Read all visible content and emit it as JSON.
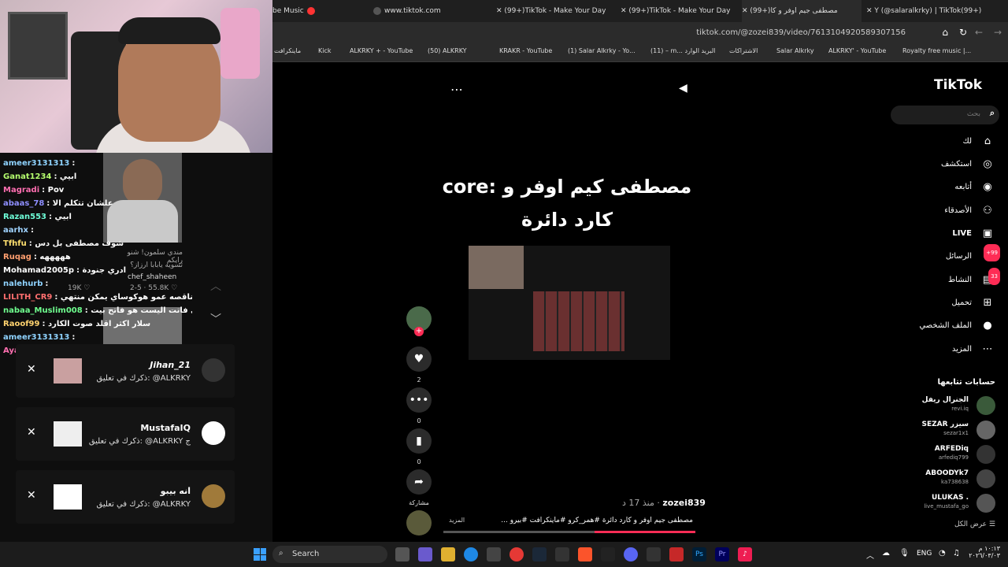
{
  "browser": {
    "tabs": [
      {
        "label": "be Music"
      },
      {
        "label": "www.tiktok.com"
      },
      {
        "label": "(99+)TikTok - Make Your Day"
      },
      {
        "label": "(99+)TikTok - Make Your Day"
      },
      {
        "label": "(99+)مصطفى جيم اوفر و كا"
      },
      {
        "label": "Y (@salaralkrky) | TikTok(99+)"
      }
    ],
    "url": "tiktok.com/@zozei839/video/7613104920589307156",
    "bookmarks": [
      "ماينكرافت",
      "Kick",
      "ALKRKY + - YouTube",
      "(50) ALKRKY",
      "KRAKR - YouTube",
      "(1) Salar Alkrky - Yo...",
      "(11) – m... البريد الوارد",
      "الاشتراكات",
      "Salar Alkrky",
      "ALKRKY' - YouTube",
      "Royalty free music |..."
    ]
  },
  "tiktok": {
    "logo": "TikTok",
    "search_placeholder": "بحث",
    "nav": [
      {
        "label": "لك",
        "icon": "home-icon"
      },
      {
        "label": "استكشف",
        "icon": "compass-icon"
      },
      {
        "label": "أتابعه",
        "icon": "following-icon"
      },
      {
        "label": "الأصدقاء",
        "icon": "friends-icon"
      },
      {
        "label": "LIVE",
        "icon": "live-icon"
      },
      {
        "label": "الرسائل",
        "icon": "messages-icon",
        "badge": "+99"
      },
      {
        "label": "النشاط",
        "icon": "activity-icon",
        "badge": "33"
      },
      {
        "label": "تحميل",
        "icon": "upload-icon"
      },
      {
        "label": "الملف الشخصي",
        "icon": "profile-icon"
      },
      {
        "label": "المزيد",
        "icon": "more-icon"
      }
    ],
    "following_title": "حسابات تتابعها",
    "following": [
      {
        "name": "الجنرال ريفل",
        "handle": "revi.iq"
      },
      {
        "name": "SEZAR سيزر",
        "handle": "sezar1x1"
      },
      {
        "name": "ARFEDiq",
        "handle": "arfediq799"
      },
      {
        "name": "ABOODYk7",
        "handle": "ka738638"
      },
      {
        "name": "ULUKAS .",
        "handle": "live_mustafa_go"
      }
    ],
    "see_all": "عرض الكل",
    "video": {
      "title": "مصطفى كيم اوفر و :core كارد دائرة",
      "author": "zozei839",
      "time": "منذ 17 د",
      "description": "مصطفى جيم اوفر و كارد دائرة #همر_كرو #ماينكرافت #بيرو ...",
      "more": "المزيد",
      "progress": 0.4,
      "likes": "2",
      "comments": "0",
      "saves": "0",
      "share_label": "مشاركة"
    }
  },
  "stream": {
    "chat": [
      {
        "user": "ameer3131313",
        "text": "",
        "color": "#8fd3ff"
      },
      {
        "user": "Ganat1234",
        "text": "ابيي",
        "color": "#b6ff6f"
      },
      {
        "user": "Magradi",
        "text": "Pov",
        "color": "#ff6fb1"
      },
      {
        "user": "abaas_78",
        "text": "علشان تتكلم الا",
        "color": "#8f8fff"
      },
      {
        "user": "Razan553",
        "text": "ابيي",
        "color": "#6fffd9"
      },
      {
        "user": "aarhx",
        "text": "",
        "color": "#9fd3ff"
      },
      {
        "user": "Tfhfu",
        "text": "شوف مصطفى بل دس",
        "color": "#ffe06f"
      },
      {
        "user": "Ruqag",
        "text": "هههههه",
        "color": "#ff9f6f"
      },
      {
        "user": "Mohamad2005p",
        "text": "ادري جنودة",
        "color": "#ffffff"
      },
      {
        "user": "nalehurb",
        "text": "",
        "color": "#8fd3ff"
      },
      {
        "user": "LILITH_CR9",
        "text": "يهلا بيبح ليوم لك ناقصه عمو هوكوساي يمكن منتهي",
        "color": "#ff6f6f"
      },
      {
        "user": "nabaa_Muslim008",
        "text": "لا تحاول إسعادي فاتت اليست هو فاتح بيت",
        "color": "#6fff8f"
      },
      {
        "user": "Raoof99",
        "text": "سلار اكثر اقلد صوت الكارد",
        "color": "#ffd36f"
      },
      {
        "user": "ameer3131313",
        "text": "",
        "color": "#8fd3ff"
      },
      {
        "user": "Ayath99",
        "text": "اي والله",
        "color": "#ff6fb1"
      }
    ],
    "card_caption": "مندي سلمون! شنو رايكم",
    "card_sub": "تسويه يابابا ارزاز؟",
    "card_handle": "chef_shaheen",
    "card_stats": "2-5 · 55.8K ♡",
    "card_stats2": "19K ♡",
    "notifications": [
      {
        "name": "Jihan_21",
        "msg": "ذكرك في تعليق: @ALKRKY"
      },
      {
        "name": "MustafaIQ",
        "msg": "ذكرك في تعليق: @ALKRKY ج"
      },
      {
        "name": "انه بيبو",
        "msg": "ذكرك في تعليق: @ALKRKY"
      }
    ]
  },
  "taskbar": {
    "search": "Search",
    "lang": "ENG",
    "time": "١٠:١٣ م",
    "date": "٢٠٢٦/٠٣/٠٣"
  }
}
